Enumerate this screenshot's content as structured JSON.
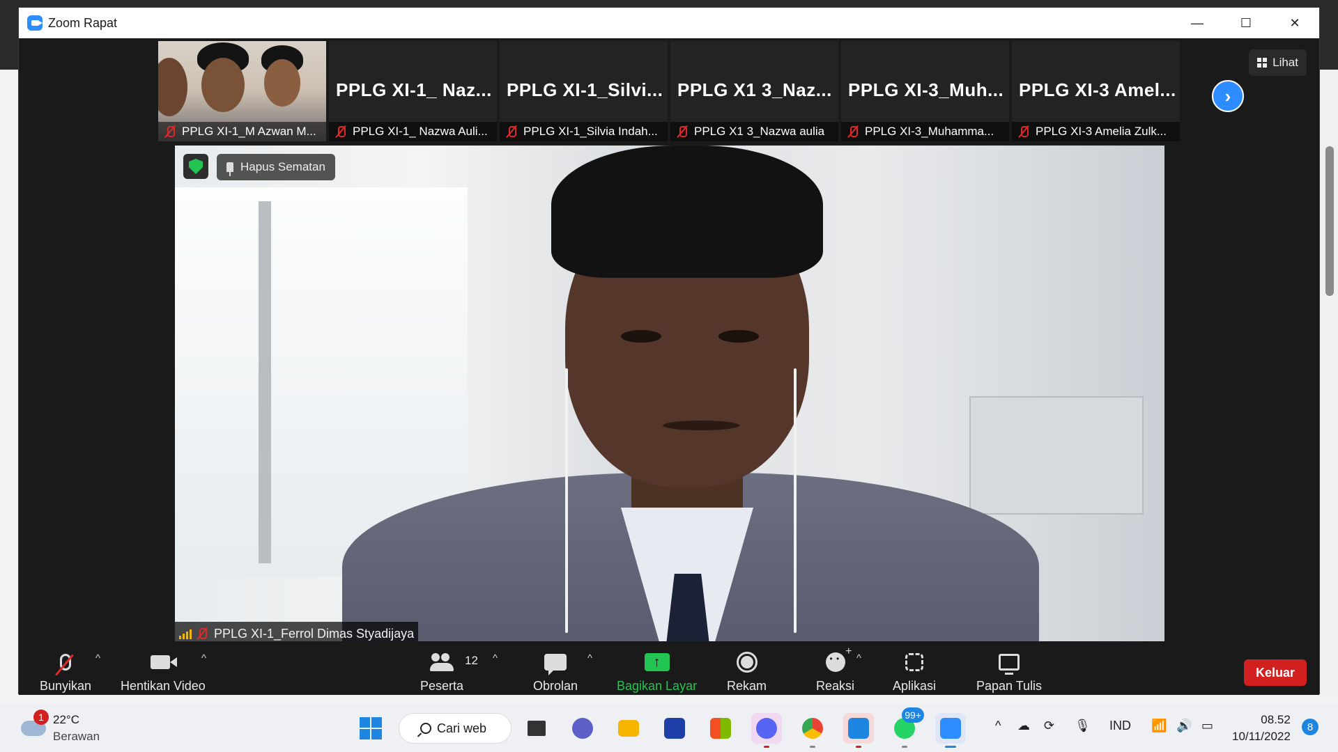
{
  "window": {
    "title": "Zoom Rapat",
    "minimize": "—",
    "maximize": "☐",
    "close": "✕"
  },
  "view_button": "Lihat",
  "gallery": [
    {
      "big_name": "",
      "caption": "PPLG XI-1_M Azwan M..."
    },
    {
      "big_name": "PPLG  XI-1_  Naz...",
      "caption": "PPLG XI-1_ Nazwa Auli..."
    },
    {
      "big_name": "PPLG  XI-1_Silvi...",
      "caption": "PPLG XI-1_Silvia Indah..."
    },
    {
      "big_name": "PPLG  X1  3_Naz...",
      "caption": "PPLG X1 3_Nazwa aulia"
    },
    {
      "big_name": "PPLG  XI-3_Muh...",
      "caption": "PPLG XI-3_Muhamma..."
    },
    {
      "big_name": "PPLG  XI-3  Amel...",
      "caption": "PPLG XI-3 Amelia Zulk..."
    }
  ],
  "gallery_next": "›",
  "main_video": {
    "unpin_label": "Hapus Sematan",
    "speaker_name": "PPLG XI-1_Ferrol Dimas Styadijaya"
  },
  "toolbar": {
    "unmute": "Bunyikan",
    "stop_video": "Hentikan Video",
    "participants": "Peserta",
    "participants_count": "12",
    "chat": "Obrolan",
    "share_screen": "Bagikan Layar",
    "record": "Rekam",
    "reactions": "Reaksi",
    "apps": "Aplikasi",
    "whiteboard": "Papan Tulis",
    "leave": "Keluar",
    "caret": "^"
  },
  "taskbar": {
    "weather_badge": "1",
    "temperature": "22°C",
    "condition": "Berawan",
    "search": "Cari web",
    "whatsapp_badge": "99+",
    "language": "IND",
    "time": "08.52",
    "date": "10/11/2022",
    "notifications": "8",
    "tray_chevron": "^"
  },
  "colors": {
    "accent_blue": "#2d8cff",
    "share_green": "#23c552",
    "leave_red": "#d21f1f",
    "mute_red": "#e02828"
  }
}
